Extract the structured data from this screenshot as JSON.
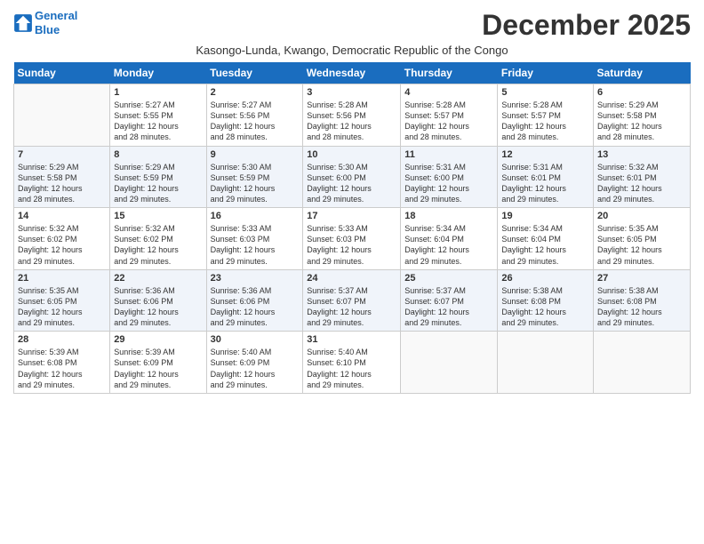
{
  "logo": {
    "line1": "General",
    "line2": "Blue"
  },
  "month_title": "December 2025",
  "subtitle": "Kasongo-Lunda, Kwango, Democratic Republic of the Congo",
  "days_of_week": [
    "Sunday",
    "Monday",
    "Tuesday",
    "Wednesday",
    "Thursday",
    "Friday",
    "Saturday"
  ],
  "weeks": [
    [
      {
        "day": "",
        "info": ""
      },
      {
        "day": "1",
        "info": "Sunrise: 5:27 AM\nSunset: 5:55 PM\nDaylight: 12 hours\nand 28 minutes."
      },
      {
        "day": "2",
        "info": "Sunrise: 5:27 AM\nSunset: 5:56 PM\nDaylight: 12 hours\nand 28 minutes."
      },
      {
        "day": "3",
        "info": "Sunrise: 5:28 AM\nSunset: 5:56 PM\nDaylight: 12 hours\nand 28 minutes."
      },
      {
        "day": "4",
        "info": "Sunrise: 5:28 AM\nSunset: 5:57 PM\nDaylight: 12 hours\nand 28 minutes."
      },
      {
        "day": "5",
        "info": "Sunrise: 5:28 AM\nSunset: 5:57 PM\nDaylight: 12 hours\nand 28 minutes."
      },
      {
        "day": "6",
        "info": "Sunrise: 5:29 AM\nSunset: 5:58 PM\nDaylight: 12 hours\nand 28 minutes."
      }
    ],
    [
      {
        "day": "7",
        "info": "Sunrise: 5:29 AM\nSunset: 5:58 PM\nDaylight: 12 hours\nand 28 minutes."
      },
      {
        "day": "8",
        "info": "Sunrise: 5:29 AM\nSunset: 5:59 PM\nDaylight: 12 hours\nand 29 minutes."
      },
      {
        "day": "9",
        "info": "Sunrise: 5:30 AM\nSunset: 5:59 PM\nDaylight: 12 hours\nand 29 minutes."
      },
      {
        "day": "10",
        "info": "Sunrise: 5:30 AM\nSunset: 6:00 PM\nDaylight: 12 hours\nand 29 minutes."
      },
      {
        "day": "11",
        "info": "Sunrise: 5:31 AM\nSunset: 6:00 PM\nDaylight: 12 hours\nand 29 minutes."
      },
      {
        "day": "12",
        "info": "Sunrise: 5:31 AM\nSunset: 6:01 PM\nDaylight: 12 hours\nand 29 minutes."
      },
      {
        "day": "13",
        "info": "Sunrise: 5:32 AM\nSunset: 6:01 PM\nDaylight: 12 hours\nand 29 minutes."
      }
    ],
    [
      {
        "day": "14",
        "info": "Sunrise: 5:32 AM\nSunset: 6:02 PM\nDaylight: 12 hours\nand 29 minutes."
      },
      {
        "day": "15",
        "info": "Sunrise: 5:32 AM\nSunset: 6:02 PM\nDaylight: 12 hours\nand 29 minutes."
      },
      {
        "day": "16",
        "info": "Sunrise: 5:33 AM\nSunset: 6:03 PM\nDaylight: 12 hours\nand 29 minutes."
      },
      {
        "day": "17",
        "info": "Sunrise: 5:33 AM\nSunset: 6:03 PM\nDaylight: 12 hours\nand 29 minutes."
      },
      {
        "day": "18",
        "info": "Sunrise: 5:34 AM\nSunset: 6:04 PM\nDaylight: 12 hours\nand 29 minutes."
      },
      {
        "day": "19",
        "info": "Sunrise: 5:34 AM\nSunset: 6:04 PM\nDaylight: 12 hours\nand 29 minutes."
      },
      {
        "day": "20",
        "info": "Sunrise: 5:35 AM\nSunset: 6:05 PM\nDaylight: 12 hours\nand 29 minutes."
      }
    ],
    [
      {
        "day": "21",
        "info": "Sunrise: 5:35 AM\nSunset: 6:05 PM\nDaylight: 12 hours\nand 29 minutes."
      },
      {
        "day": "22",
        "info": "Sunrise: 5:36 AM\nSunset: 6:06 PM\nDaylight: 12 hours\nand 29 minutes."
      },
      {
        "day": "23",
        "info": "Sunrise: 5:36 AM\nSunset: 6:06 PM\nDaylight: 12 hours\nand 29 minutes."
      },
      {
        "day": "24",
        "info": "Sunrise: 5:37 AM\nSunset: 6:07 PM\nDaylight: 12 hours\nand 29 minutes."
      },
      {
        "day": "25",
        "info": "Sunrise: 5:37 AM\nSunset: 6:07 PM\nDaylight: 12 hours\nand 29 minutes."
      },
      {
        "day": "26",
        "info": "Sunrise: 5:38 AM\nSunset: 6:08 PM\nDaylight: 12 hours\nand 29 minutes."
      },
      {
        "day": "27",
        "info": "Sunrise: 5:38 AM\nSunset: 6:08 PM\nDaylight: 12 hours\nand 29 minutes."
      }
    ],
    [
      {
        "day": "28",
        "info": "Sunrise: 5:39 AM\nSunset: 6:08 PM\nDaylight: 12 hours\nand 29 minutes."
      },
      {
        "day": "29",
        "info": "Sunrise: 5:39 AM\nSunset: 6:09 PM\nDaylight: 12 hours\nand 29 minutes."
      },
      {
        "day": "30",
        "info": "Sunrise: 5:40 AM\nSunset: 6:09 PM\nDaylight: 12 hours\nand 29 minutes."
      },
      {
        "day": "31",
        "info": "Sunrise: 5:40 AM\nSunset: 6:10 PM\nDaylight: 12 hours\nand 29 minutes."
      },
      {
        "day": "",
        "info": ""
      },
      {
        "day": "",
        "info": ""
      },
      {
        "day": "",
        "info": ""
      }
    ]
  ]
}
